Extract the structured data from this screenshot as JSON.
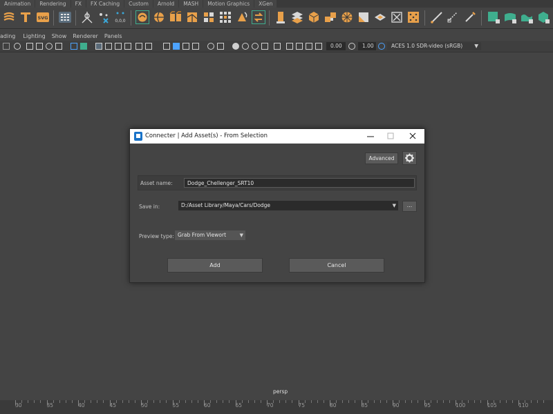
{
  "shelf_tabs": [
    "Animation",
    "Rendering",
    "FX",
    "FX Caching",
    "Custom",
    "Arnold",
    "MASH",
    "Motion Graphics",
    "XGen"
  ],
  "panel_menu": [
    "ading",
    "Lighting",
    "Show",
    "Renderer",
    "Panels"
  ],
  "panel_toolbar": {
    "exposure": "0.00",
    "gamma": "1.00",
    "color_space": "ACES 1.0 SDR-video (sRGB)"
  },
  "viewport": {
    "camera": "persp"
  },
  "timeline": {
    "ticks": [
      "30",
      "35",
      "40",
      "45",
      "50",
      "55",
      "60",
      "65",
      "70",
      "75",
      "80",
      "85",
      "90",
      "95",
      "100",
      "105",
      "110"
    ]
  },
  "dialog": {
    "title": "Connecter | Add Asset(s) - From Selection",
    "advanced_label": "Advanced",
    "asset_name_label": "Asset name:",
    "asset_name_value": "Dodge_Chellenger_SRT10",
    "save_in_label": "Save in:",
    "save_in_value": "D:/Asset Library/Maya/Cars/Dodge",
    "browse_label": "...",
    "preview_type_label": "Preview type:",
    "preview_type_value": "Grab From Viewort",
    "add_label": "Add",
    "cancel_label": "Cancel"
  },
  "colors": {
    "shelf_orange": "#e8a04a",
    "shelf_teal": "#3fae8e",
    "dialog_bg": "#444444",
    "field_bg": "#2b2b2b"
  }
}
